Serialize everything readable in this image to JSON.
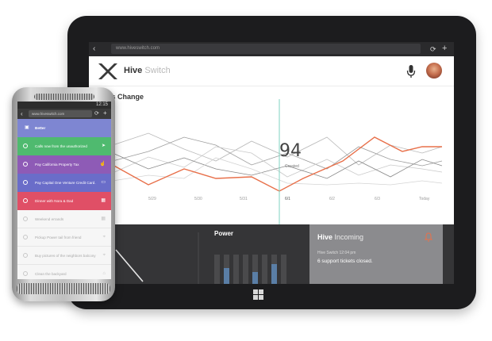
{
  "tablet": {
    "browser": {
      "url": "www.hiveswitch.com"
    },
    "header": {
      "brand_bold": "Hive",
      "brand_light": "Switch"
    },
    "chart_title": "ances Change",
    "counter": {
      "value": "94",
      "label": "Created"
    },
    "x_ticks": [
      "5/29",
      "5/30",
      "5/31",
      "6/1",
      "6/2",
      "6/3",
      "Today"
    ],
    "power_title": "Power",
    "hive_card": {
      "title_bold": "Hive",
      "title_light": "Incoming",
      "sub": "Hive Switch 12:04 pm",
      "body": "6 support tickets closed."
    },
    "colors": {
      "accent": "#e8704a",
      "marker": "#7fd3c0",
      "bar_blue": "#5a7ea6"
    }
  },
  "phone": {
    "brand": "htc",
    "status_time": "12:15",
    "browser_url": "www.hiveswitch.com",
    "header": {
      "label": "Better"
    },
    "items": [
      {
        "text": "Calls now from the unauthorized",
        "color": "#4fba6f",
        "icon": "arrow-icon",
        "glyph": "➤"
      },
      {
        "text": "Pay California Property Tax",
        "color": "#8e5bb6",
        "icon": "hand-icon",
        "glyph": "☝"
      },
      {
        "text": "Pay Capital One Venture Credit Card.",
        "color": "#6a6dc9",
        "icon": "card-icon",
        "glyph": "▭"
      },
      {
        "text": "Dinner with Nora & Dad",
        "color": "#e04f66",
        "icon": "calendar-icon",
        "glyph": "▦"
      }
    ],
    "light_items": [
      {
        "text": "Weekend errands",
        "glyph": "▦"
      },
      {
        "text": "Pickup Power tail from friend",
        "glyph": "⌖"
      },
      {
        "text": "Buy pictures of the neighbors balcony",
        "glyph": "⌖"
      },
      {
        "text": "Clean the backyard",
        "glyph": "⌂"
      }
    ],
    "header_color": "#7e86d2"
  }
}
